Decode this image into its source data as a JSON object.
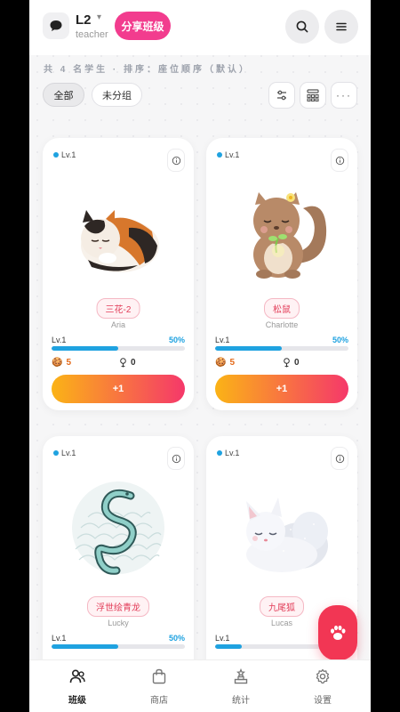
{
  "header": {
    "class_name": "L2",
    "role": "teacher",
    "share_label": "分享班级"
  },
  "toolbar": {
    "summary": "共 4 名学生 · 排序：座位顺序（默认）",
    "filter_all": "全部",
    "filter_ungrouped": "未分组"
  },
  "cards": [
    {
      "level_tag": "Lv.1",
      "pet_name": "三花-2",
      "student": "Aria",
      "xp_label": "Lv.1",
      "xp_percent_text": "50%",
      "xp_fraction": 0.5,
      "food": "5",
      "badges": "0",
      "plus_label": "+1"
    },
    {
      "level_tag": "Lv.1",
      "pet_name": "松鼠",
      "student": "Charlotte",
      "xp_label": "Lv.1",
      "xp_percent_text": "50%",
      "xp_fraction": 0.5,
      "food": "5",
      "badges": "0",
      "plus_label": "+1"
    },
    {
      "level_tag": "Lv.1",
      "pet_name": "浮世绘青龙",
      "student": "Lucky",
      "xp_label": "Lv.1",
      "xp_percent_text": "50%",
      "xp_fraction": 0.5
    },
    {
      "level_tag": "Lv.1",
      "pet_name": "九尾狐",
      "student": "Lucas",
      "xp_label": "Lv.1",
      "xp_percent_text": "",
      "xp_fraction": 0.2
    }
  ],
  "bottom_nav": [
    {
      "label": "班级",
      "icon": "people-icon",
      "active": true
    },
    {
      "label": "商店",
      "icon": "shopping-bag-icon",
      "active": false
    },
    {
      "label": "统计",
      "icon": "podium-icon",
      "active": false
    },
    {
      "label": "设置",
      "icon": "gear-icon",
      "active": false
    }
  ],
  "colors": {
    "accent_pink": "#f23c8e",
    "xp_blue": "#1fa2e0",
    "button_gradient_start": "#fbb316",
    "button_gradient_end": "#f5386a",
    "fab_red": "#f23654"
  }
}
